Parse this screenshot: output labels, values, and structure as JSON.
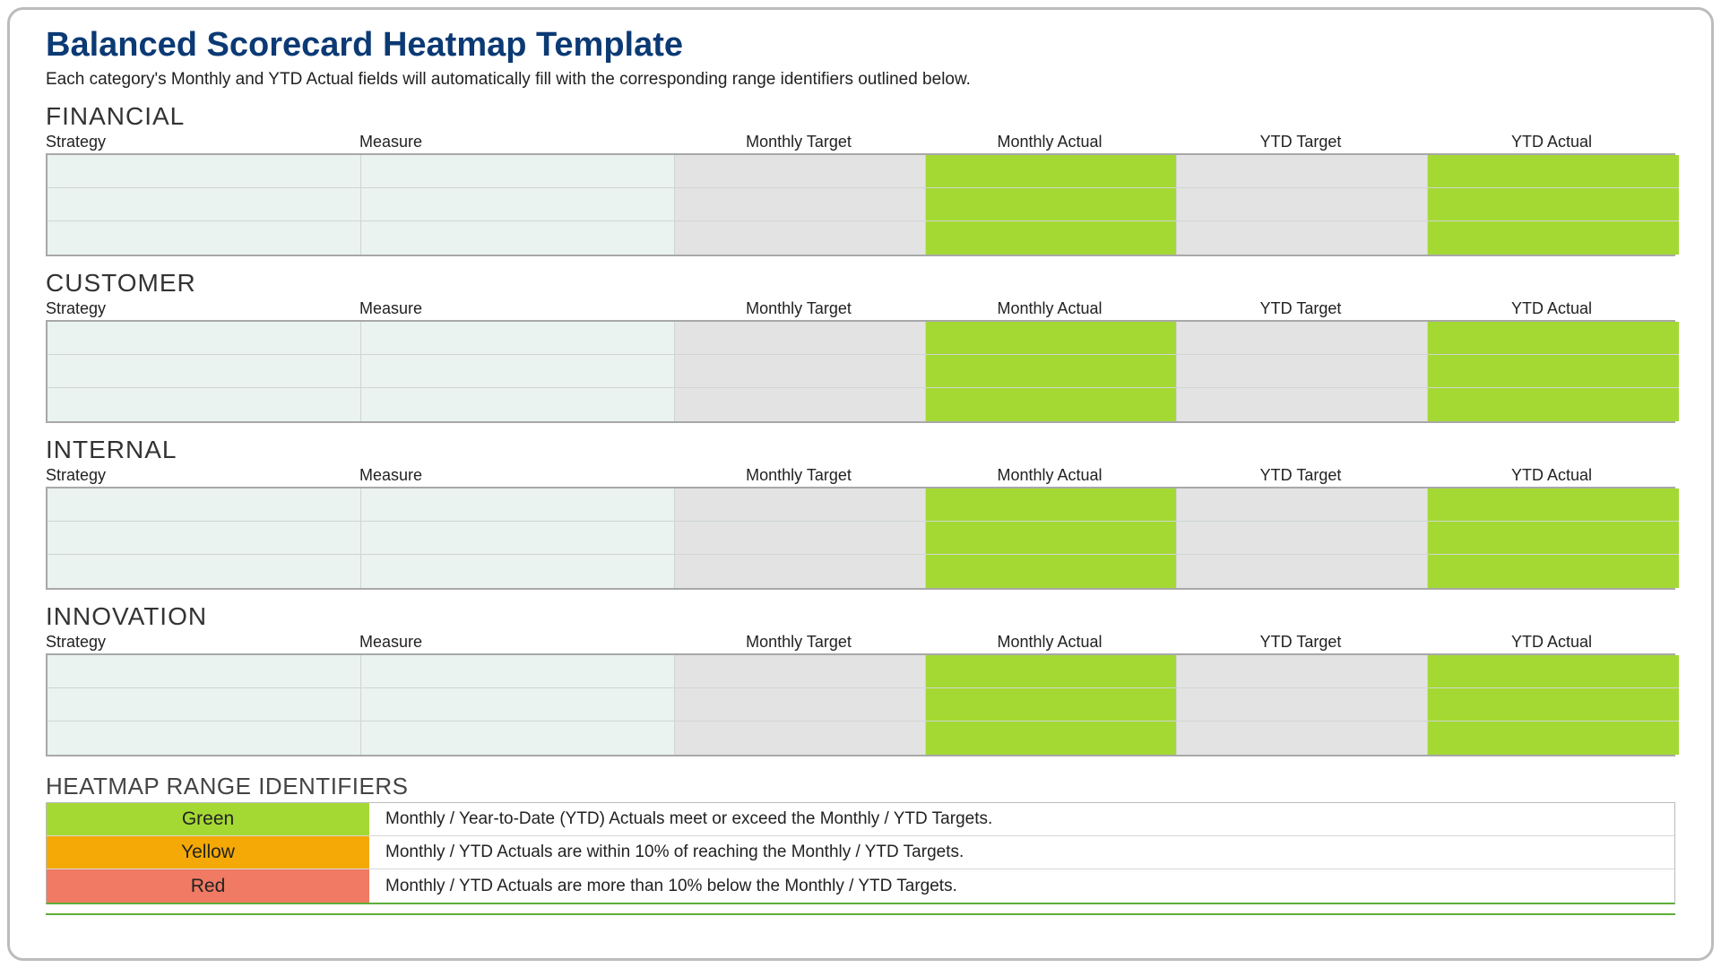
{
  "title": "Balanced Scorecard Heatmap Template",
  "subtitle": "Each category's Monthly and YTD Actual fields will automatically fill with the corresponding range identifiers outlined below.",
  "columns": {
    "strategy": "Strategy",
    "measure": "Measure",
    "monthly_target": "Monthly Target",
    "monthly_actual": "Monthly Actual",
    "ytd_target": "YTD Target",
    "ytd_actual": "YTD Actual"
  },
  "sections": {
    "financial": {
      "title": "FINANCIAL"
    },
    "customer": {
      "title": "CUSTOMER"
    },
    "internal": {
      "title": "INTERNAL"
    },
    "innovation": {
      "title": "INNOVATION"
    }
  },
  "range": {
    "title": "HEATMAP RANGE IDENTIFIERS",
    "items": [
      {
        "label": "Green",
        "color": "#a4d934",
        "desc": "Monthly / Year-to-Date (YTD) Actuals meet or exceed the Monthly / YTD Targets."
      },
      {
        "label": "Yellow",
        "color": "#f5a906",
        "desc": "Monthly / YTD Actuals are within 10% of reaching the Monthly / YTD Targets."
      },
      {
        "label": "Red",
        "color": "#f07a63",
        "desc": "Monthly / YTD Actuals are more than 10% below the Monthly / YTD Targets."
      }
    ]
  },
  "chart_data": {
    "type": "heatmap",
    "title": "Balanced Scorecard Heatmap Template",
    "perspectives": [
      "FINANCIAL",
      "CUSTOMER",
      "INTERNAL",
      "INNOVATION"
    ],
    "columns": [
      "Strategy",
      "Measure",
      "Monthly Target",
      "Monthly Actual",
      "YTD Target",
      "YTD Actual"
    ],
    "rows_per_perspective": 3,
    "cell_colors_per_row": [
      "#eaf3ef",
      "#eaf3ef",
      "#e3e3e3",
      "#a4d934",
      "#e3e3e3",
      "#a4d934"
    ],
    "legend": [
      {
        "name": "Green",
        "color": "#a4d934",
        "meaning": "Actuals meet or exceed Targets"
      },
      {
        "name": "Yellow",
        "color": "#f5a906",
        "meaning": "Actuals within 10% of Targets"
      },
      {
        "name": "Red",
        "color": "#f07a63",
        "meaning": "Actuals more than 10% below Targets"
      }
    ]
  }
}
